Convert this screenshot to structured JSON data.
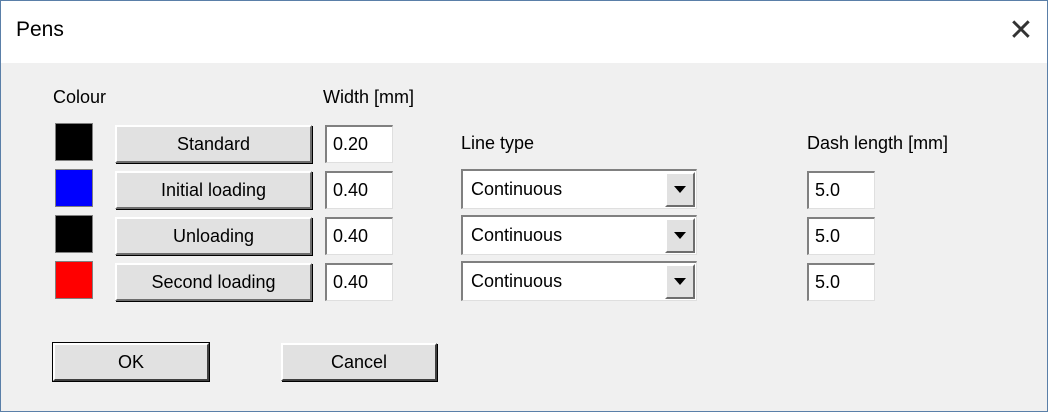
{
  "window": {
    "title": "Pens",
    "close_symbol": "✕"
  },
  "headers": {
    "colour": "Colour",
    "width": "Width [mm]",
    "line_type": "Line type",
    "dash_length": "Dash length [mm]"
  },
  "pens": [
    {
      "label": "Standard",
      "color": "#000000",
      "width": "0.20"
    },
    {
      "label": "Initial loading",
      "color": "#0000ff",
      "width": "0.40",
      "line_type": "Continuous",
      "dash_length": "5.0"
    },
    {
      "label": "Unloading",
      "color": "#000000",
      "width": "0.40",
      "line_type": "Continuous",
      "dash_length": "5.0"
    },
    {
      "label": "Second loading",
      "color": "#ff0000",
      "width": "0.40",
      "line_type": "Continuous",
      "dash_length": "5.0"
    }
  ],
  "buttons": {
    "ok": "OK",
    "cancel": "Cancel"
  },
  "icons": {
    "close": "close-icon",
    "dropdown": "chevron-down-icon"
  }
}
